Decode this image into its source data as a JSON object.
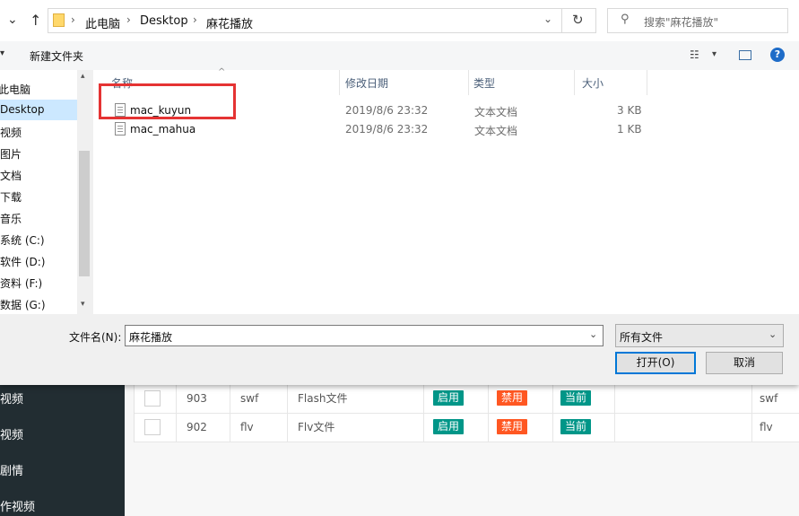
{
  "background_page": {
    "sidebar_items": [
      "视频",
      "视频",
      "剧情",
      "作视频"
    ],
    "rows": [
      {
        "id": "903",
        "ext": "swf",
        "name": "Flash文件",
        "enable": "启用",
        "disable": "禁用",
        "current": "当前",
        "ext2": "swf"
      },
      {
        "id": "902",
        "ext": "flv",
        "name": "Flv文件",
        "enable": "启用",
        "disable": "禁用",
        "current": "当前",
        "ext2": "flv"
      }
    ]
  },
  "dialog": {
    "breadcrumb": [
      "此电脑",
      "Desktop",
      "麻花播放"
    ],
    "search_placeholder": "搜索\"麻花播放\"",
    "toolbar": {
      "new_folder_label": "新建文件夹"
    },
    "nav_items": [
      "此电脑",
      "Desktop",
      "视频",
      "图片",
      "文档",
      "下载",
      "音乐",
      "系统 (C:)",
      "软件 (D:)",
      "资料 (F:)",
      "数据 (G:)"
    ],
    "columns": {
      "name": "名称",
      "modified": "修改日期",
      "type": "类型",
      "size": "大小"
    },
    "files": [
      {
        "name": "mac_kuyun",
        "modified": "2019/8/6 23:32",
        "type": "文本文档",
        "size": "3 KB"
      },
      {
        "name": "mac_mahua",
        "modified": "2019/8/6 23:32",
        "type": "文本文档",
        "size": "1 KB"
      }
    ],
    "filename_label": "文件名(N):",
    "filename_value": "麻花播放",
    "filetype_value": "所有文件",
    "open_button": "打开(O)",
    "cancel_button": "取消"
  },
  "colors": {
    "highlight": "#e53333",
    "tag_green": "#009688",
    "tag_orange": "#ff5722",
    "sidebar_bg": "#222d32"
  }
}
